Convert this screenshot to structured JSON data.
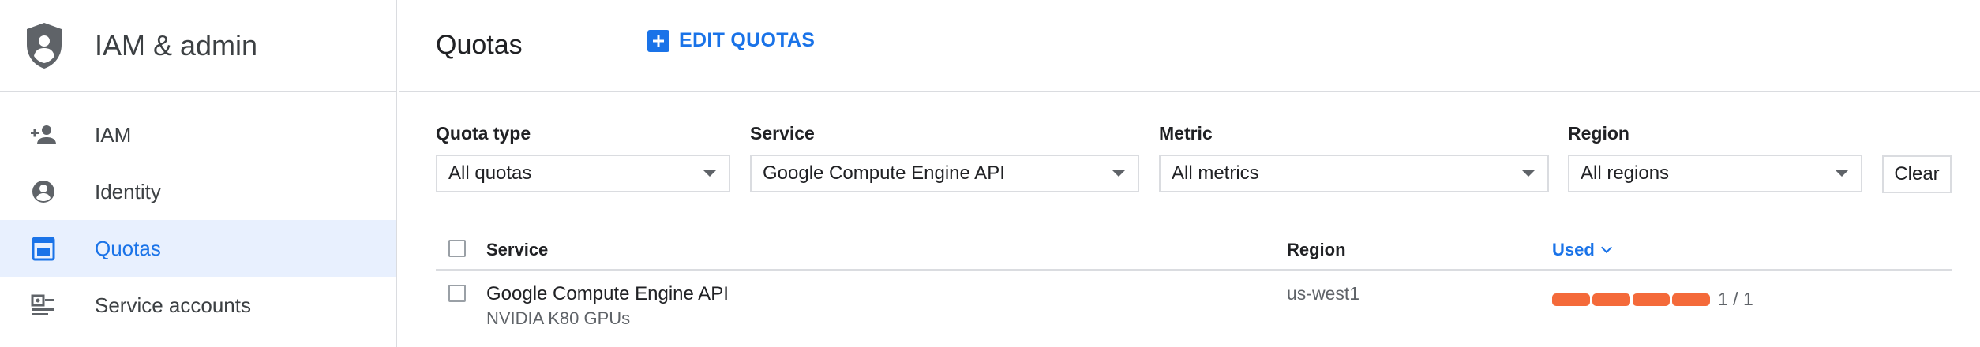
{
  "sidebar": {
    "title": "IAM & admin",
    "items": [
      {
        "label": "IAM",
        "icon": "person-add-icon"
      },
      {
        "label": "Identity",
        "icon": "account-circle-icon"
      },
      {
        "label": "Quotas",
        "icon": "quota-icon",
        "active": true
      },
      {
        "label": "Service accounts",
        "icon": "service-account-icon"
      }
    ]
  },
  "header": {
    "title": "Quotas",
    "edit_button": "EDIT QUOTAS"
  },
  "filters": {
    "quota_type": {
      "label": "Quota type",
      "value": "All quotas"
    },
    "service": {
      "label": "Service",
      "value": "Google Compute Engine API"
    },
    "metric": {
      "label": "Metric",
      "value": "All metrics"
    },
    "region": {
      "label": "Region",
      "value": "All regions"
    },
    "clear_label": "Clear"
  },
  "table": {
    "columns": {
      "service": "Service",
      "region": "Region",
      "used": "Used"
    },
    "rows": [
      {
        "service": "Google Compute Engine API",
        "metric": "NVIDIA K80 GPUs",
        "region": "us-west1",
        "used_text": "1 / 1",
        "used_fraction": 1.0
      }
    ]
  },
  "colors": {
    "accent": "#1a73e8",
    "usage_bar": "#f46a3a",
    "active_bg": "#e8f0fe"
  }
}
